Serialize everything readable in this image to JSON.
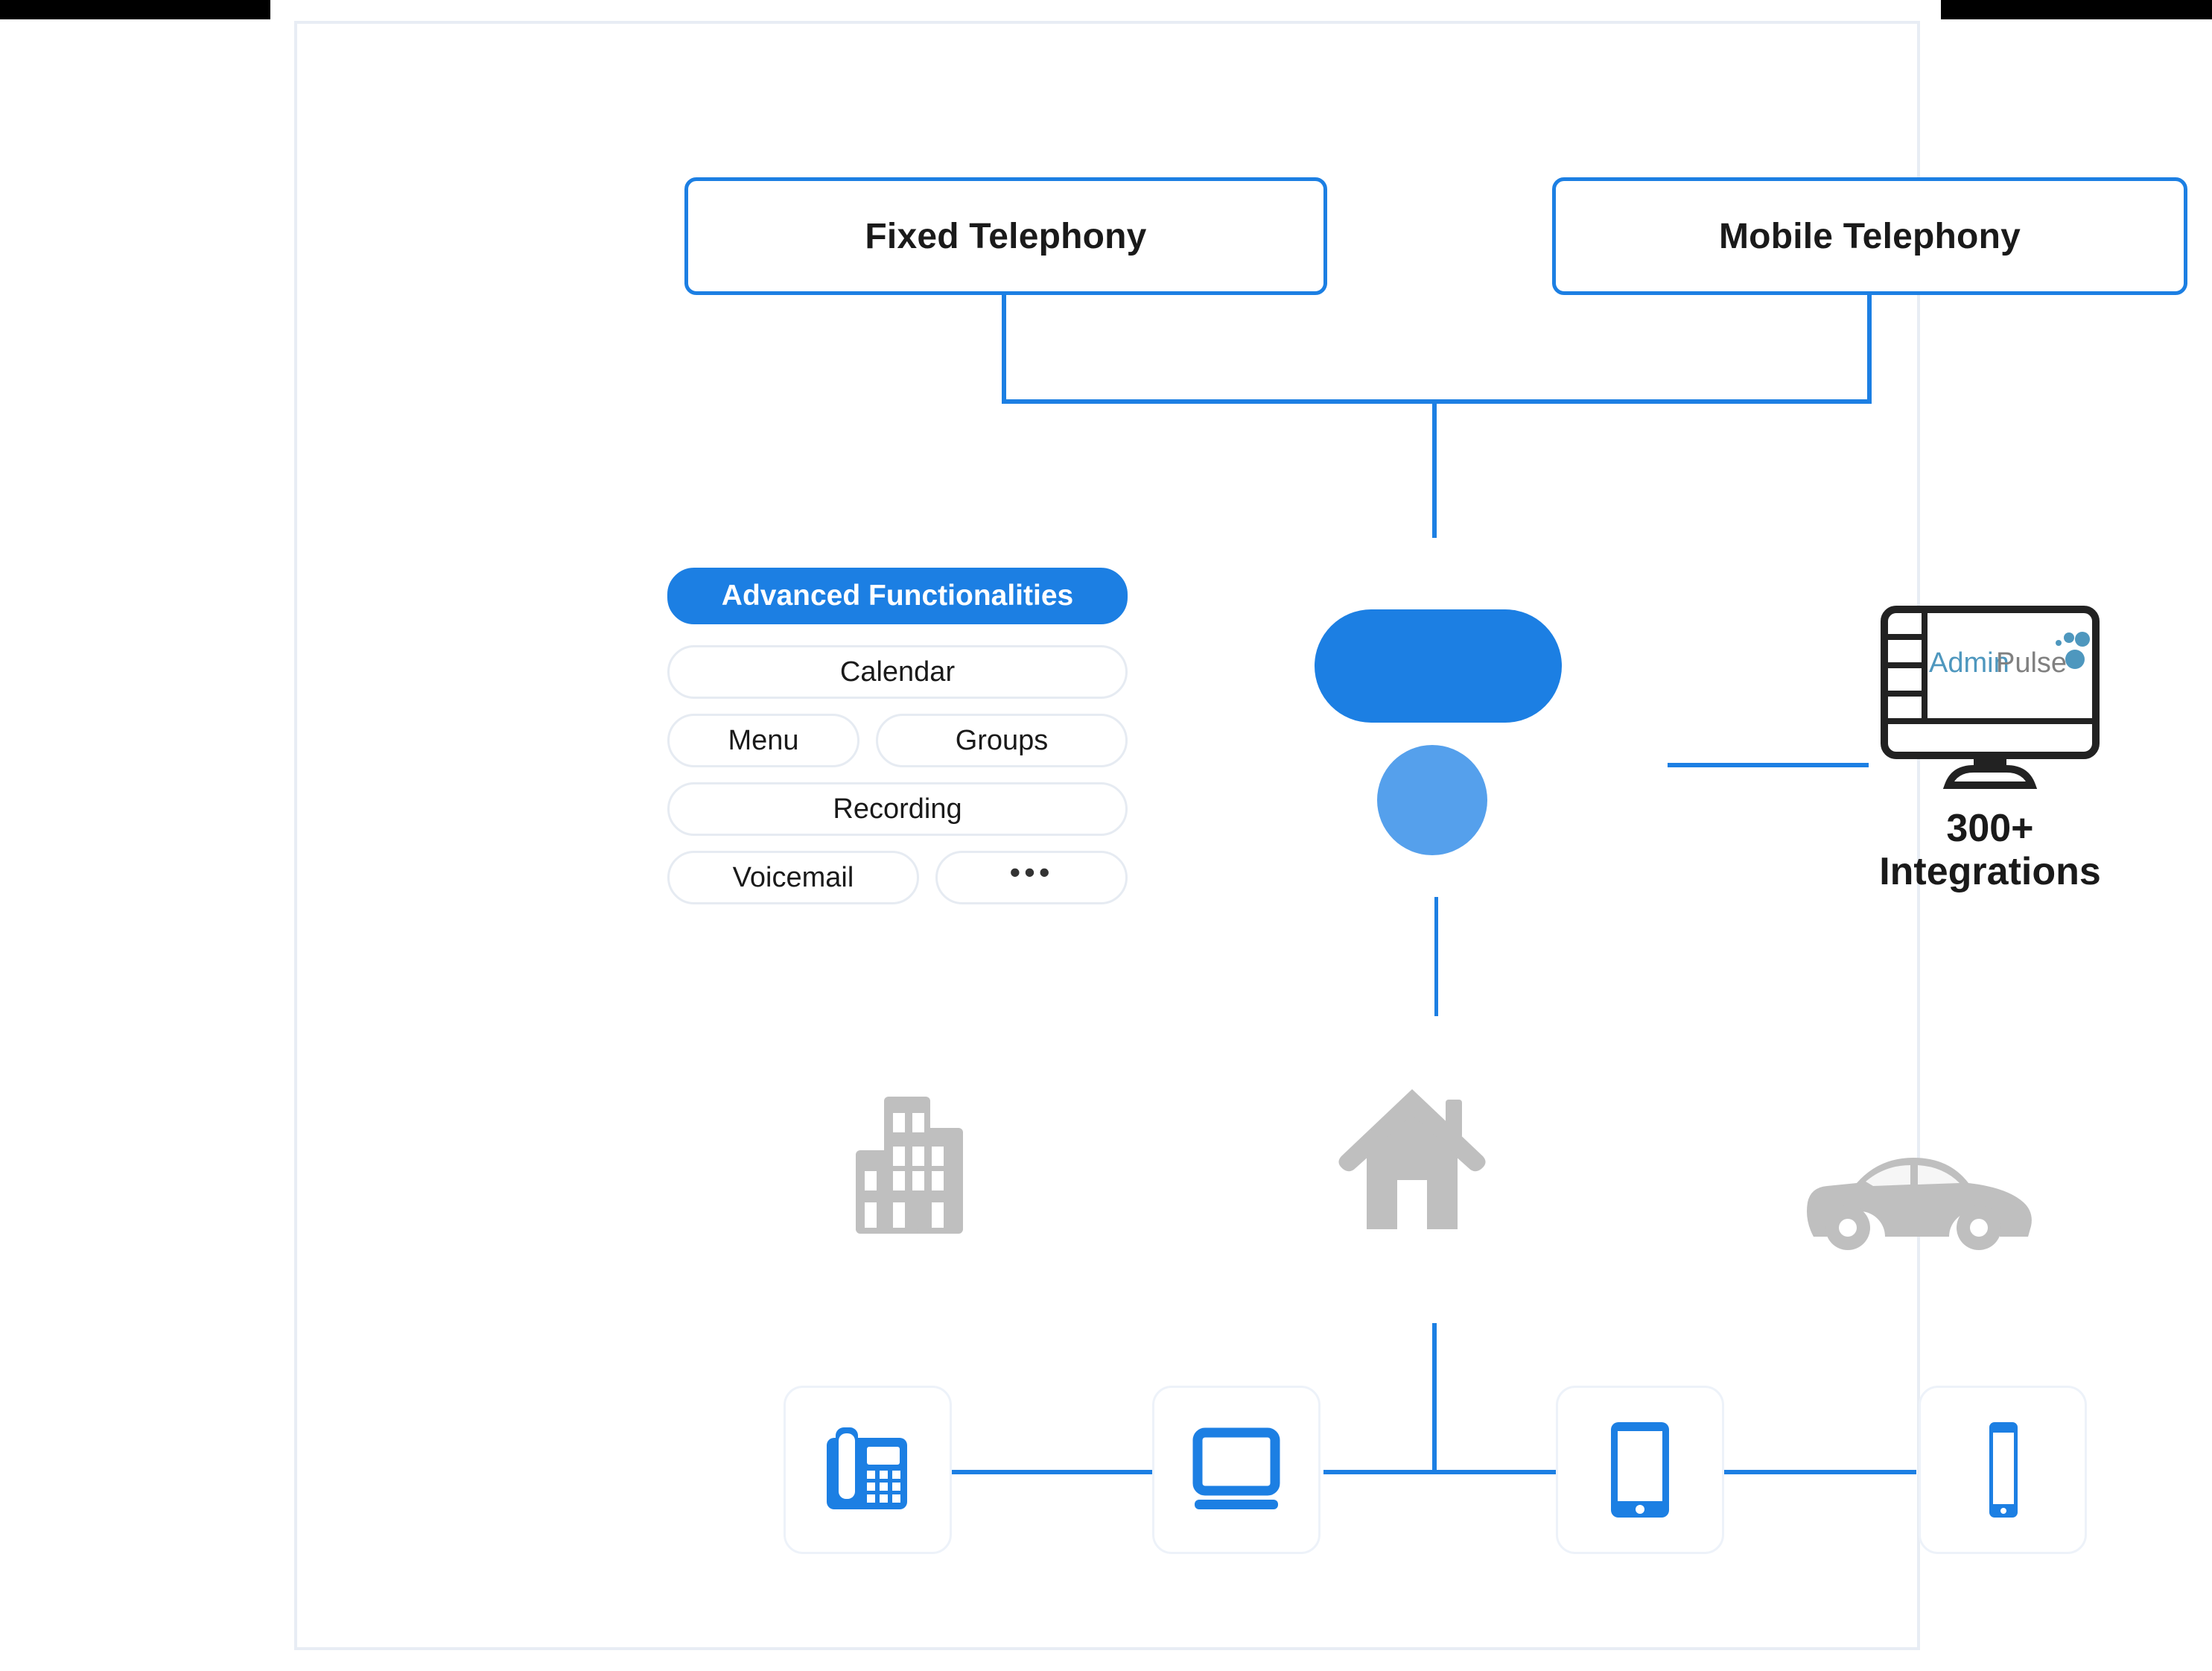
{
  "frame": {
    "border_color": "#E8EDF4"
  },
  "colors": {
    "primary_blue": "#1C7FE3",
    "light_blue": "#55A0EC",
    "gray_icon": "#BFBFBF",
    "pill_border": "#E6EBF2"
  },
  "telephony": {
    "fixed_label": "Fixed Telephony",
    "mobile_label": "Mobile Telephony"
  },
  "functions": {
    "header_label": "Advanced Functionalities",
    "rows": [
      [
        {
          "label": "Calendar",
          "wide": true
        }
      ],
      [
        {
          "label": "Menu",
          "wide": false
        },
        {
          "label": "Groups",
          "wide": false
        }
      ],
      [
        {
          "label": "Recording",
          "wide": true
        }
      ],
      [
        {
          "label": "Voicemail",
          "wide": false
        },
        {
          "label": "•••",
          "wide": false
        }
      ]
    ]
  },
  "integrations": {
    "logo_first": "Admin",
    "logo_second": "Pulse",
    "count_label": "300+",
    "caption_label": "Integrations"
  },
  "places": [
    {
      "name": "office-building"
    },
    {
      "name": "house"
    },
    {
      "name": "car"
    }
  ],
  "devices": [
    {
      "name": "desk-phone"
    },
    {
      "name": "laptop"
    },
    {
      "name": "tablet"
    },
    {
      "name": "smartphone"
    }
  ]
}
